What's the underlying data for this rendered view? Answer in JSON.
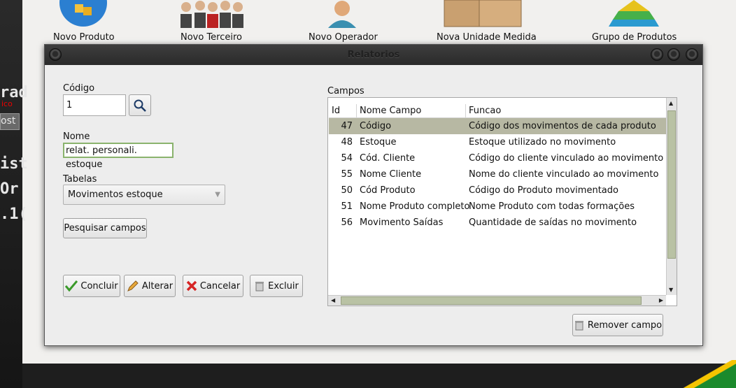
{
  "launcher": [
    {
      "label": "Novo Produto",
      "icon": "product-box-icon"
    },
    {
      "label": "Novo Terceiro",
      "icon": "people-group-icon"
    },
    {
      "label": "Novo Operador",
      "icon": "operator-user-icon"
    },
    {
      "label": "Nova Unidade Medida",
      "icon": "boxes-icon"
    },
    {
      "label": "Grupo de Produtos",
      "icon": "pyramid-icon"
    }
  ],
  "background": {
    "fragments": [
      "rad",
      "ico",
      "ost",
      "ist",
      "Or",
      ".1("
    ]
  },
  "dialog": {
    "title": "Relatorios",
    "codigo_label": "Código",
    "codigo_value": "1",
    "nome_label": "Nome",
    "nome_value": "relat. personali. estoque",
    "tabelas_label": "Tabelas",
    "tabelas_value": "Movimentos estoque",
    "pesquisar_label": "Pesquisar campos",
    "concluir_label": "Concluir",
    "alterar_label": "Alterar",
    "cancelar_label": "Cancelar",
    "excluir_label": "Excluir",
    "campos_label": "Campos",
    "remover_label": "Remover campo",
    "columns": {
      "id": "Id",
      "nome": "Nome Campo",
      "funcao": "Funcao"
    },
    "rows": [
      {
        "id": "47",
        "nome": "Código",
        "funcao": "Código dos movimentos de cada produto"
      },
      {
        "id": "48",
        "nome": "Estoque",
        "funcao": "Estoque utilizado no movimento"
      },
      {
        "id": "54",
        "nome": "Cód. Cliente",
        "funcao": "Código do cliente vinculado ao movimento"
      },
      {
        "id": "55",
        "nome": "Nome Cliente",
        "funcao": "Nome do cliente vinculado ao movimento"
      },
      {
        "id": "50",
        "nome": "Cód Produto",
        "funcao": "Código do Produto movimentado"
      },
      {
        "id": "51",
        "nome": "Nome Produto completo",
        "funcao": "Nome Produto com todas formações"
      },
      {
        "id": "56",
        "nome": "Movimento Saídas",
        "funcao": "Quantidade de saídas no movimento"
      }
    ]
  },
  "colors": {
    "selected_row": "#b7b8a3",
    "scroll_thumb": "#b9c2a4"
  }
}
